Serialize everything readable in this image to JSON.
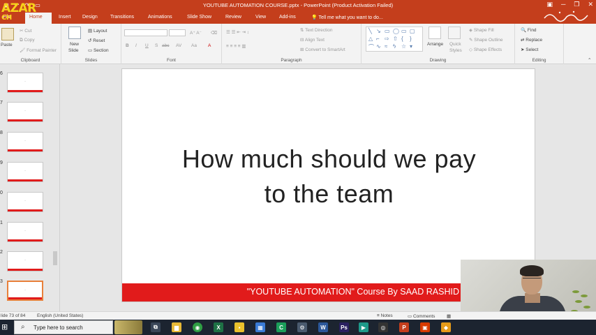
{
  "window": {
    "title": "YOUTUBE AUTOMATION COURSE.pptx - PowerPoint (Product Activation Failed)"
  },
  "overlay": {
    "logo_line1": "AZAR",
    "logo_line2": "CH"
  },
  "tabs": [
    "File",
    "Home",
    "Insert",
    "Design",
    "Transitions",
    "Animations",
    "Slide Show",
    "Review",
    "View",
    "Add-ins"
  ],
  "tellme": "Tell me what you want to do...",
  "ribbon": {
    "clipboard": {
      "label": "Clipboard",
      "paste": "Paste",
      "cut": "Cut",
      "copy": "Copy",
      "format_painter": "Format Painter"
    },
    "slides": {
      "label": "Slides",
      "new_slide": "New",
      "new_slide2": "Slide",
      "layout": "Layout",
      "reset": "Reset",
      "section": "Section"
    },
    "font": {
      "label": "Font",
      "bold": "B",
      "italic": "I",
      "underline": "U",
      "strike": "S",
      "shadow": "abc",
      "spacing": "AV",
      "case": "Aa",
      "color": "A"
    },
    "paragraph": {
      "label": "Paragraph",
      "text_direction": "Text Direction",
      "align_text": "Align Text",
      "convert_smartart": "Convert to SmartArt"
    },
    "drawing": {
      "label": "Drawing",
      "arrange": "Arrange",
      "quick_styles": "Quick",
      "quick_styles2": "Styles",
      "shape_fill": "Shape Fill",
      "shape_outline": "Shape Outline",
      "shape_effects": "Shape Effects"
    },
    "editing": {
      "label": "Editing",
      "find": "Find",
      "replace": "Replace",
      "select": "Select"
    }
  },
  "thumbnails": [
    {
      "num": "6",
      "text": "..."
    },
    {
      "num": "7",
      "text": "..."
    },
    {
      "num": "8",
      "text": "..."
    },
    {
      "num": "9",
      "text": "..."
    },
    {
      "num": "0",
      "text": "..."
    },
    {
      "num": "1",
      "text": "..."
    },
    {
      "num": "2",
      "text": "..."
    },
    {
      "num": "3",
      "text": "..."
    }
  ],
  "slide": {
    "title_line1": "How much should we pay",
    "title_line2": "to the team",
    "banner": "\"YOUTUBE AUTOMATION\" Course By SAAD RASHID"
  },
  "status": {
    "slide_info": "lide 73 of 84",
    "language": "English (United States)",
    "notes": "Notes",
    "comments": "Comments"
  },
  "taskbar": {
    "search_placeholder": "Type here to search"
  },
  "colors": {
    "ppt_accent": "#c43e1c",
    "banner_red": "#e11b1b"
  }
}
